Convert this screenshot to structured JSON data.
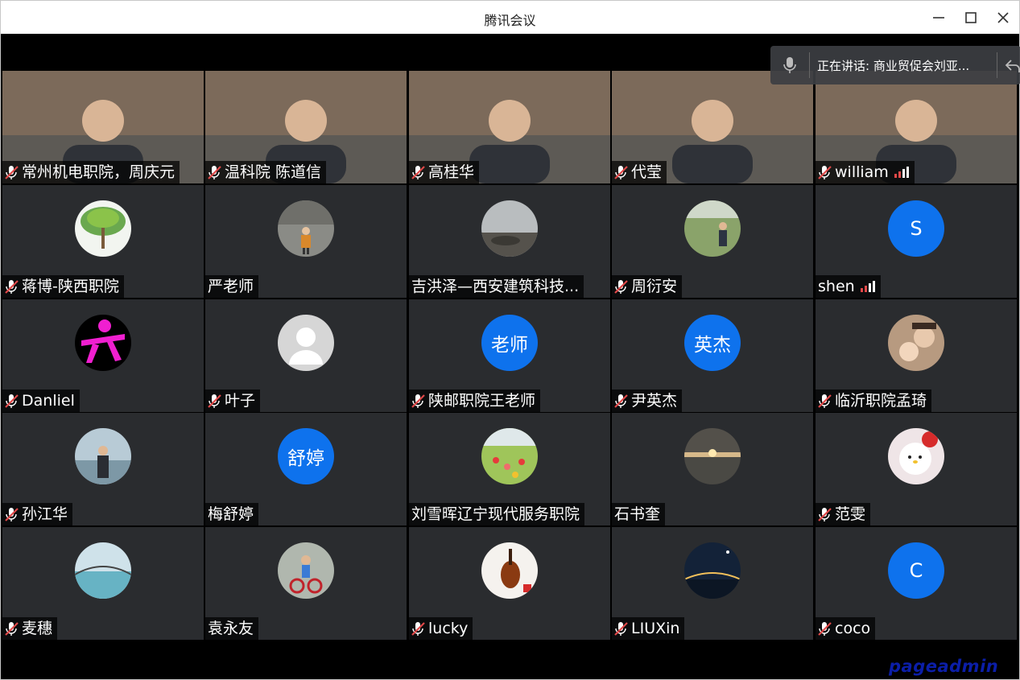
{
  "window": {
    "title": "腾讯会议"
  },
  "speaking_banner": {
    "text": "正在讲话: 商业贸促会刘亚..."
  },
  "participants": [
    {
      "name": "常州机电职院，周庆元",
      "muted": true,
      "video": true,
      "signal": false
    },
    {
      "name": "温科院 陈道信",
      "muted": true,
      "video": true,
      "signal": false
    },
    {
      "name": "高桂华",
      "muted": true,
      "video": true,
      "signal": false
    },
    {
      "name": "代莹",
      "muted": true,
      "video": true,
      "signal": false
    },
    {
      "name": "william",
      "muted": true,
      "video": true,
      "signal": true
    },
    {
      "name": "蒋博-陕西职院",
      "muted": true,
      "avatar": "tree-photo",
      "signal": false
    },
    {
      "name": "严老师",
      "muted": false,
      "avatar": "person-outdoor-photo",
      "signal": false
    },
    {
      "name": "吉洪泽—西安建筑科技...",
      "muted": false,
      "avatar": "seaside-rocks-photo",
      "signal": false
    },
    {
      "name": "周衍安",
      "muted": true,
      "avatar": "person-lawn-photo",
      "signal": false
    },
    {
      "name": "shen",
      "muted": false,
      "avatar_letter": "S",
      "signal": true
    },
    {
      "name": "Danliel",
      "muted": true,
      "avatar": "pink-logo",
      "signal": false
    },
    {
      "name": "叶子",
      "muted": true,
      "avatar": "default-silhouette",
      "signal": false
    },
    {
      "name": "陕邮职院王老师",
      "muted": true,
      "avatar_letter": "老师",
      "signal": false
    },
    {
      "name": "尹英杰",
      "muted": true,
      "avatar_letter": "英杰",
      "signal": false
    },
    {
      "name": "临沂职院孟琦",
      "muted": true,
      "avatar": "family-photo",
      "signal": false
    },
    {
      "name": "孙江华",
      "muted": true,
      "avatar": "person-beach-photo",
      "signal": false
    },
    {
      "name": "梅舒婷",
      "muted": false,
      "avatar_letter": "舒婷",
      "signal": false
    },
    {
      "name": "刘雪晖辽宁现代服务职院",
      "muted": false,
      "avatar": "flower-field-photo",
      "signal": false
    },
    {
      "name": "石书奎",
      "muted": false,
      "avatar": "sunset-photo",
      "signal": false
    },
    {
      "name": "范雯",
      "muted": true,
      "avatar": "hello-kitty-photo",
      "signal": false
    },
    {
      "name": "麦穗",
      "muted": true,
      "avatar": "bridge-photo",
      "signal": false
    },
    {
      "name": "袁永友",
      "muted": false,
      "avatar": "child-bike-photo",
      "signal": false
    },
    {
      "name": "lucky",
      "muted": true,
      "avatar": "violin-photo",
      "signal": false
    },
    {
      "name": "LIUXin",
      "muted": true,
      "avatar": "night-bridge-photo",
      "signal": false
    },
    {
      "name": "coco",
      "muted": true,
      "avatar_letter": "C",
      "signal": false
    }
  ],
  "colors": {
    "accent": "#0e72ed",
    "muted_icon": "#e04848",
    "signal": "#e04848"
  },
  "watermark": "pageadmin"
}
